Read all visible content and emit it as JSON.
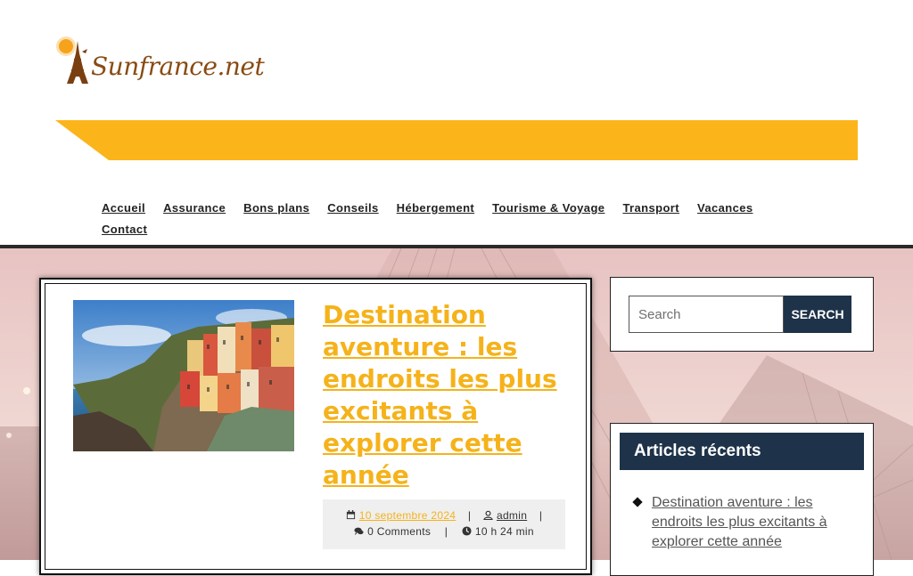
{
  "site": {
    "logo_text": "Sunfrance.net"
  },
  "colors": {
    "accent": "#f5b21a",
    "band": "#fbb41a",
    "navy": "#1e3349",
    "nav_text": "#222222"
  },
  "nav": [
    {
      "label": "Accueil"
    },
    {
      "label": "Assurance"
    },
    {
      "label": "Bons plans"
    },
    {
      "label": "Conseils"
    },
    {
      "label": "Hébergement"
    },
    {
      "label": "Tourisme & Voyage"
    },
    {
      "label": "Transport"
    },
    {
      "label": "Vacances"
    },
    {
      "label": "Contact"
    }
  ],
  "post": {
    "title": "Destination aventure : les endroits les plus excitants à explorer cette année",
    "date": "10 septembre 2024",
    "author": "admin",
    "comments": "0 Comments",
    "time": "10 h 24 min",
    "separator": "|"
  },
  "sidebar": {
    "search": {
      "placeholder": "Search",
      "button": "SEARCH"
    },
    "recent": {
      "heading": "Articles récents",
      "items": [
        {
          "title": "Destination aventure : les endroits les plus excitants à explorer cette année"
        }
      ]
    }
  },
  "icons": [
    "calendar-icon",
    "user-icon",
    "comments-icon",
    "clock-icon",
    "diamond-bullet-icon"
  ]
}
